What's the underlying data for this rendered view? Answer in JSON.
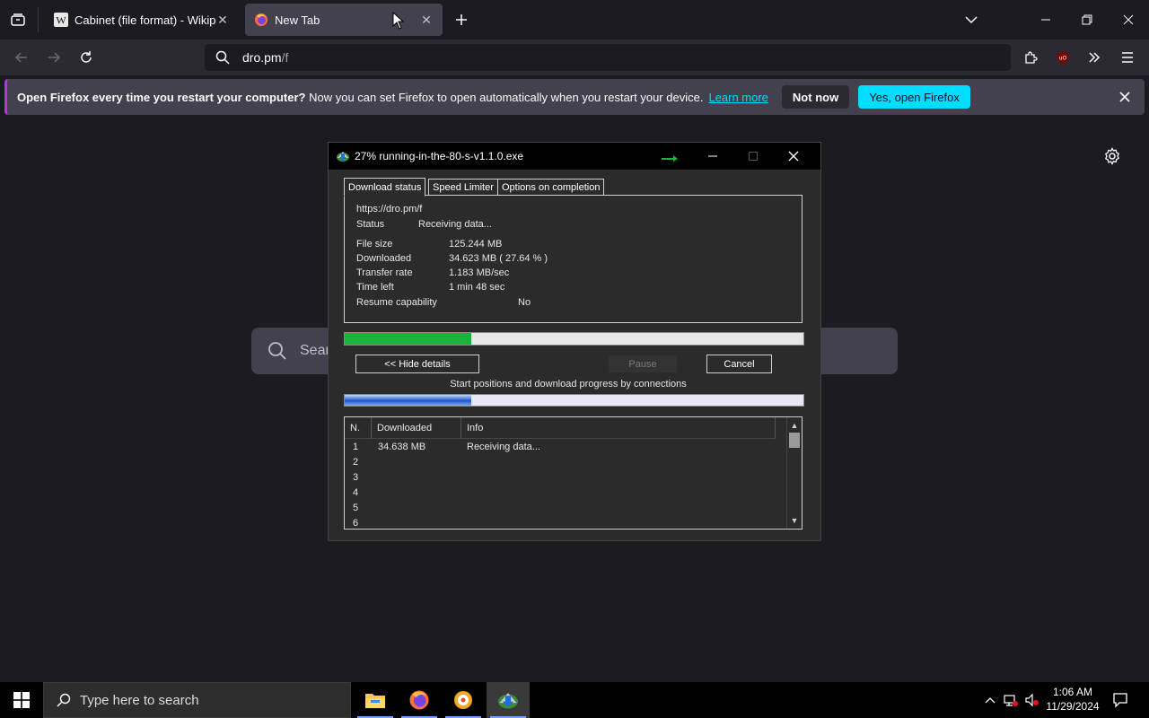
{
  "browser": {
    "tabs": [
      {
        "title": "Cabinet (file format) - Wikipedia",
        "favicon": "wikipedia-icon",
        "active": false
      },
      {
        "title": "New Tab",
        "favicon": "firefox-icon",
        "active": true
      }
    ],
    "url": {
      "host": "dro.pm",
      "path": "/f"
    }
  },
  "notification": {
    "bold_text": "Open Firefox every time you restart your computer?",
    "text": "Now you can set Firefox to open automatically when you restart your device.",
    "link": "Learn more",
    "not_now": "Not now",
    "yes": "Yes, open Firefox"
  },
  "newtab": {
    "search_placeholder": "Sear"
  },
  "idm": {
    "title": "27% running-in-the-80-s-v1.1.0.exe",
    "tabs": [
      "Download status",
      "Speed Limiter",
      "Options on completion"
    ],
    "url": "https://dro.pm/f",
    "status_label": "Status",
    "status_value": "Receiving data...",
    "file_size_label": "File size",
    "file_size_value": "125.244  MB",
    "downloaded_label": "Downloaded",
    "downloaded_value": "34.623  MB  ( 27.64 % )",
    "transfer_rate_label": "Transfer rate",
    "transfer_rate_value": "1.183  MB/sec",
    "time_left_label": "Time left",
    "time_left_value": "1 min 48 sec",
    "resume_label": "Resume capability",
    "resume_value": "No",
    "progress": 0.2764,
    "connection_progress": 0.2764,
    "hide_details": "<< Hide details",
    "pause": "Pause",
    "cancel": "Cancel",
    "connections_caption": "Start positions and download progress by connections",
    "columns": [
      "N.",
      "Downloaded",
      "Info"
    ],
    "connections": [
      {
        "n": "1",
        "downloaded": "34.638  MB",
        "info": "Receiving data..."
      },
      {
        "n": "2",
        "downloaded": "",
        "info": ""
      },
      {
        "n": "3",
        "downloaded": "",
        "info": ""
      },
      {
        "n": "4",
        "downloaded": "",
        "info": ""
      },
      {
        "n": "5",
        "downloaded": "",
        "info": ""
      },
      {
        "n": "6",
        "downloaded": "",
        "info": ""
      }
    ]
  },
  "taskbar": {
    "search_placeholder": "Type here to search",
    "time": "1:06 AM",
    "date": "11/29/2024",
    "apps": [
      "file-explorer-icon",
      "firefox-icon",
      "media-app-icon",
      "idm-icon"
    ]
  },
  "colors": {
    "firefox_accent": "#00ddff",
    "progress_green": "#19b53a",
    "notification_stripe": "#b833e1"
  }
}
